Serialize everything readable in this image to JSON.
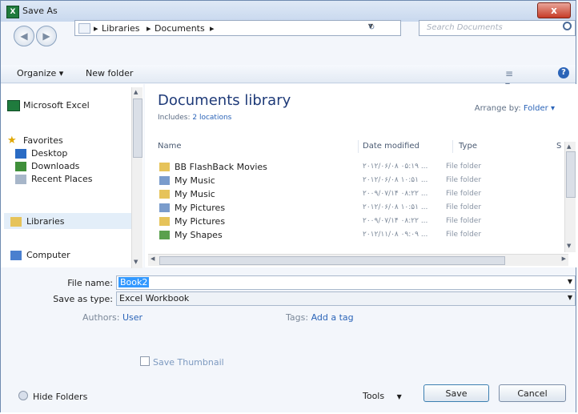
{
  "window": {
    "title": "Save As",
    "app_icon_letter": "X",
    "close_symbol": "x"
  },
  "address": {
    "crumbs": [
      "Libraries",
      "Documents"
    ],
    "search_placeholder": "Search Documents"
  },
  "toolbar": {
    "organize_label": "Organize ▾",
    "new_folder_label": "New folder",
    "view_symbol": "≡ ▾",
    "help_symbol": "?"
  },
  "nav": {
    "items": [
      {
        "label": "Microsoft Excel",
        "icon": "excel-icon"
      },
      {
        "label": "Favorites",
        "icon": "star-icon"
      },
      {
        "label": "Desktop",
        "icon": "desktop-icon"
      },
      {
        "label": "Downloads",
        "icon": "downloads-icon"
      },
      {
        "label": "Recent Places",
        "icon": "recent-icon"
      },
      {
        "label": "Libraries",
        "icon": "libraries-icon"
      },
      {
        "label": "Computer",
        "icon": "computer-icon"
      }
    ]
  },
  "library": {
    "title": "Documents library",
    "includes_label": "Includes:",
    "includes_link": "2 locations",
    "arrange_label": "Arrange by:",
    "arrange_value": "Folder ▾"
  },
  "columns": {
    "name": "Name",
    "date": "Date modified",
    "type": "Type",
    "size": "S"
  },
  "files": [
    {
      "name": "BB FlashBack Movies",
      "date": "۲۰۱۲/۰۶/۰۸ ۰۵:۱۹ ...",
      "type": "File folder",
      "icon": "folder-icon"
    },
    {
      "name": "My Music",
      "date": "۲۰۱۲/۰۶/۰۸ ۱۰:۵۱ ...",
      "type": "File folder",
      "icon": "music-icon"
    },
    {
      "name": "My Music",
      "date": "۲۰۰۹/۰۷/۱۴ ۰۸:۲۲ ...",
      "type": "File folder",
      "icon": "folder-icon"
    },
    {
      "name": "My Pictures",
      "date": "۲۰۱۲/۰۶/۰۸ ۱۰:۵۱ ...",
      "type": "File folder",
      "icon": "pictures-icon"
    },
    {
      "name": "My Pictures",
      "date": "۲۰۰۹/۰۷/۱۴ ۰۸:۲۲ ...",
      "type": "File folder",
      "icon": "folder-icon"
    },
    {
      "name": "My Shapes",
      "date": "۲۰۱۲/۱۱/۰۸ ۰۹:۰۹ ...",
      "type": "File folder",
      "icon": "shapes-icon"
    }
  ],
  "form": {
    "file_name_label": "File name:",
    "file_name_value": "Book2",
    "save_type_label": "Save as type:",
    "save_type_value": "Excel Workbook",
    "authors_label": "Authors:",
    "authors_value": "User",
    "tags_label": "Tags:",
    "tags_value": "Add a tag",
    "thumbnail_label": "Save Thumbnail"
  },
  "footer": {
    "hide_folders": "Hide Folders",
    "tools": "Tools",
    "save": "Save",
    "cancel": "Cancel"
  },
  "colors": {
    "title_bar": "#c8d8ee",
    "link": "#2b64b8",
    "selection": "#3399ff",
    "close": "#c63b27"
  }
}
